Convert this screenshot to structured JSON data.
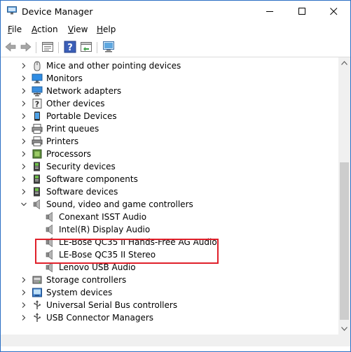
{
  "window": {
    "title": "Device Manager"
  },
  "menu": [
    {
      "label": "File",
      "ul": "F",
      "rest": "ile"
    },
    {
      "label": "Action",
      "ul": "A",
      "rest": "ction"
    },
    {
      "label": "View",
      "ul": "V",
      "rest": "iew"
    },
    {
      "label": "Help",
      "ul": "H",
      "rest": "elp"
    }
  ],
  "tree": [
    {
      "label": "Mice and other pointing devices",
      "level": 0,
      "expander": "collapsed",
      "icon": "mouse-icon"
    },
    {
      "label": "Monitors",
      "level": 0,
      "expander": "collapsed",
      "icon": "monitor-icon"
    },
    {
      "label": "Network adapters",
      "level": 0,
      "expander": "collapsed",
      "icon": "network-adapter-icon"
    },
    {
      "label": "Other devices",
      "level": 0,
      "expander": "collapsed",
      "icon": "unknown-device-icon"
    },
    {
      "label": "Portable Devices",
      "level": 0,
      "expander": "collapsed",
      "icon": "portable-device-icon"
    },
    {
      "label": "Print queues",
      "level": 0,
      "expander": "collapsed",
      "icon": "print-queue-icon"
    },
    {
      "label": "Printers",
      "level": 0,
      "expander": "collapsed",
      "icon": "printer-icon"
    },
    {
      "label": "Processors",
      "level": 0,
      "expander": "collapsed",
      "icon": "processor-icon"
    },
    {
      "label": "Security devices",
      "level": 0,
      "expander": "collapsed",
      "icon": "security-device-icon"
    },
    {
      "label": "Software components",
      "level": 0,
      "expander": "collapsed",
      "icon": "software-component-icon"
    },
    {
      "label": "Software devices",
      "level": 0,
      "expander": "collapsed",
      "icon": "software-device-icon"
    },
    {
      "label": "Sound, video and game controllers",
      "level": 0,
      "expander": "expanded",
      "icon": "speaker-icon"
    },
    {
      "label": "Conexant ISST Audio",
      "level": 1,
      "expander": "none",
      "icon": "speaker-icon"
    },
    {
      "label": "Intel(R) Display Audio",
      "level": 1,
      "expander": "none",
      "icon": "speaker-icon"
    },
    {
      "label": "LE-Bose QC35 II Hands-Free AG Audio",
      "level": 1,
      "expander": "none",
      "icon": "speaker-icon"
    },
    {
      "label": "LE-Bose QC35 II Stereo",
      "level": 1,
      "expander": "none",
      "icon": "speaker-icon"
    },
    {
      "label": "Lenovo USB Audio",
      "level": 1,
      "expander": "none",
      "icon": "speaker-icon"
    },
    {
      "label": "Storage controllers",
      "level": 0,
      "expander": "collapsed",
      "icon": "storage-controller-icon"
    },
    {
      "label": "System devices",
      "level": 0,
      "expander": "collapsed",
      "icon": "system-device-icon"
    },
    {
      "label": "Universal Serial Bus controllers",
      "level": 0,
      "expander": "collapsed",
      "icon": "usb-icon"
    },
    {
      "label": "USB Connector Managers",
      "level": 0,
      "expander": "collapsed",
      "icon": "usb-icon"
    }
  ],
  "colors": {
    "highlight_border": "#e0202a",
    "window_border": "#2b6fc4"
  }
}
